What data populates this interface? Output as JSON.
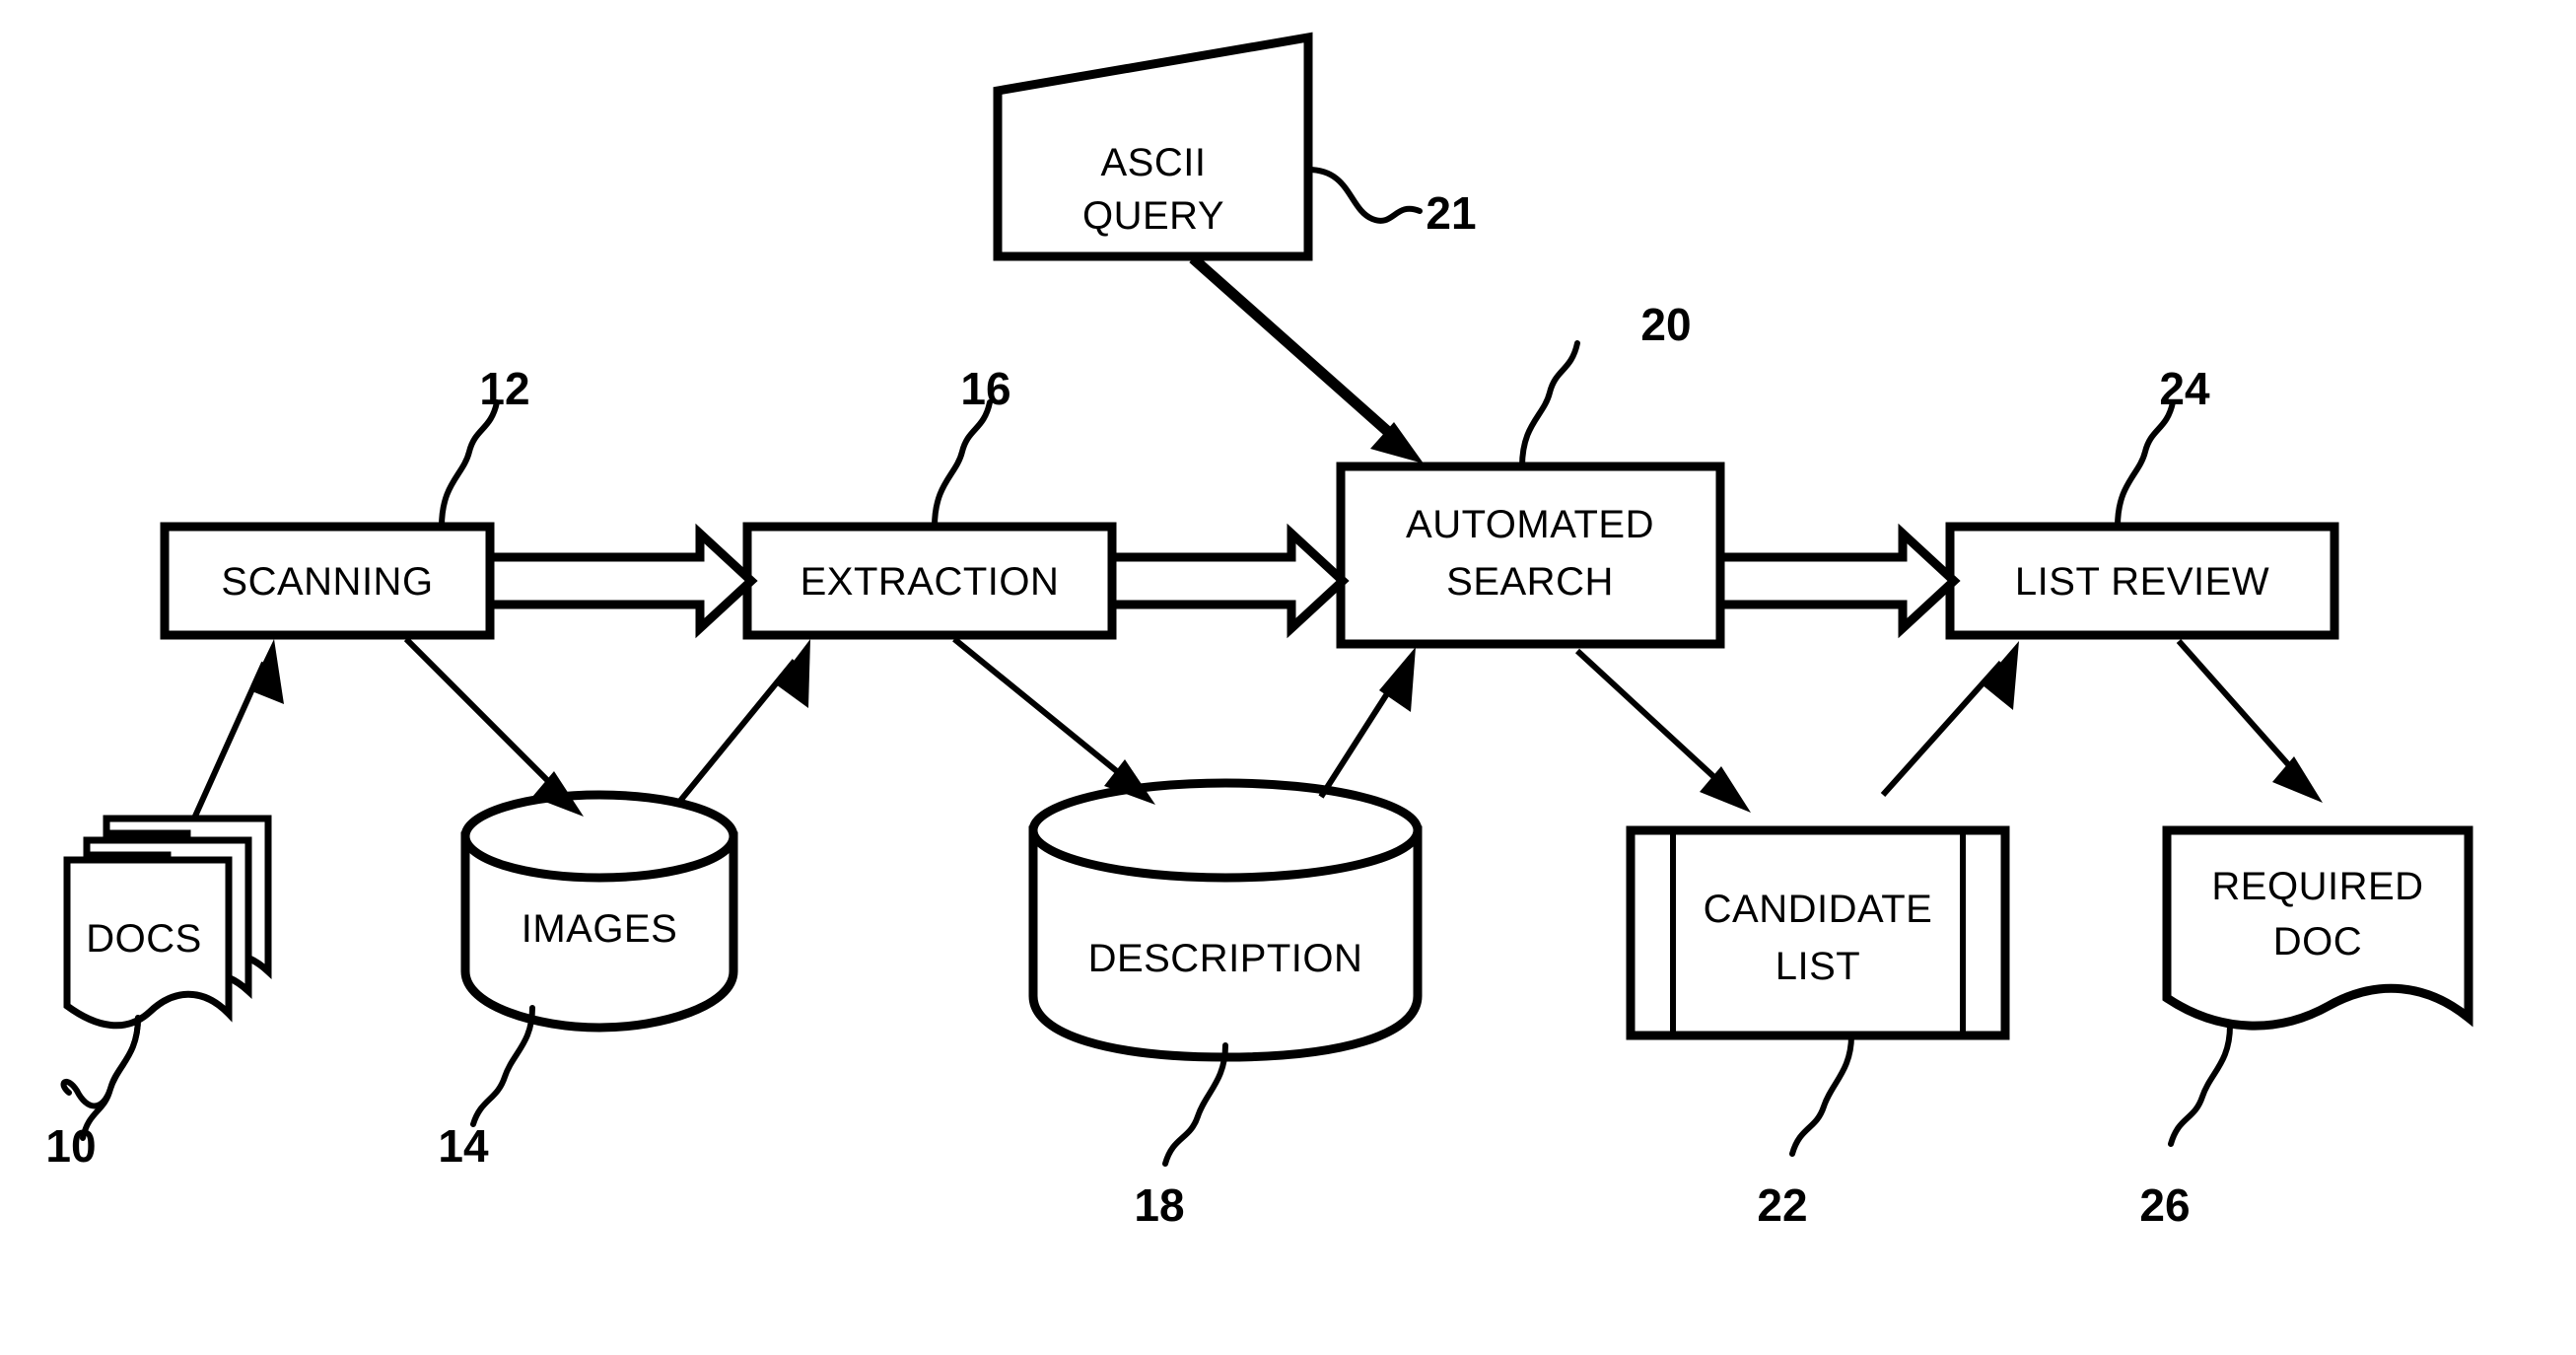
{
  "figure": {
    "type": "patent-flow-diagram",
    "background_color": "#ffffff",
    "ink_color": "#000000"
  },
  "process_boxes": [
    {
      "id": "scanning",
      "label": "SCANNING",
      "ref": "12"
    },
    {
      "id": "extraction",
      "label": "EXTRACTION",
      "ref": "16"
    },
    {
      "id": "automated_search",
      "label_line1": "AUTOMATED",
      "label_line2": "SEARCH",
      "ref": "20"
    },
    {
      "id": "list_review",
      "label": "LIST REVIEW",
      "ref": "24"
    }
  ],
  "input_box": {
    "id": "ascii_query",
    "label_line1": "ASCII",
    "label_line2": "QUERY",
    "ref": "21",
    "shape": "slanted-quadrilateral"
  },
  "data_stores": [
    {
      "id": "docs",
      "label": "DOCS",
      "ref": "10",
      "shape": "document-stack"
    },
    {
      "id": "images",
      "label": "IMAGES",
      "ref": "14",
      "shape": "cylinder"
    },
    {
      "id": "description",
      "label": "DESCRIPTION",
      "ref": "18",
      "shape": "cylinder"
    },
    {
      "id": "candidate_list",
      "label_line1": "CANDIDATE",
      "label_line2": "LIST",
      "ref": "22",
      "shape": "printout"
    },
    {
      "id": "required_doc",
      "label_line1": "REQUIRED",
      "label_line2": "DOC",
      "ref": "26",
      "shape": "document"
    }
  ],
  "reference_numerals": [
    "10",
    "12",
    "14",
    "16",
    "18",
    "20",
    "21",
    "22",
    "24",
    "26"
  ],
  "flow_block_arrows": [
    {
      "from": "scanning",
      "to": "extraction"
    },
    {
      "from": "extraction",
      "to": "automated_search"
    },
    {
      "from": "automated_search",
      "to": "list_review"
    }
  ],
  "flow_line_arrows": [
    {
      "from": "docs",
      "to": "scanning"
    },
    {
      "from": "scanning",
      "to": "images"
    },
    {
      "from": "images",
      "to": "extraction"
    },
    {
      "from": "extraction",
      "to": "description"
    },
    {
      "from": "description",
      "to": "automated_search"
    },
    {
      "from": "ascii_query",
      "to": "automated_search"
    },
    {
      "from": "automated_search",
      "to": "candidate_list"
    },
    {
      "from": "candidate_list",
      "to": "list_review"
    },
    {
      "from": "list_review",
      "to": "required_doc"
    }
  ]
}
